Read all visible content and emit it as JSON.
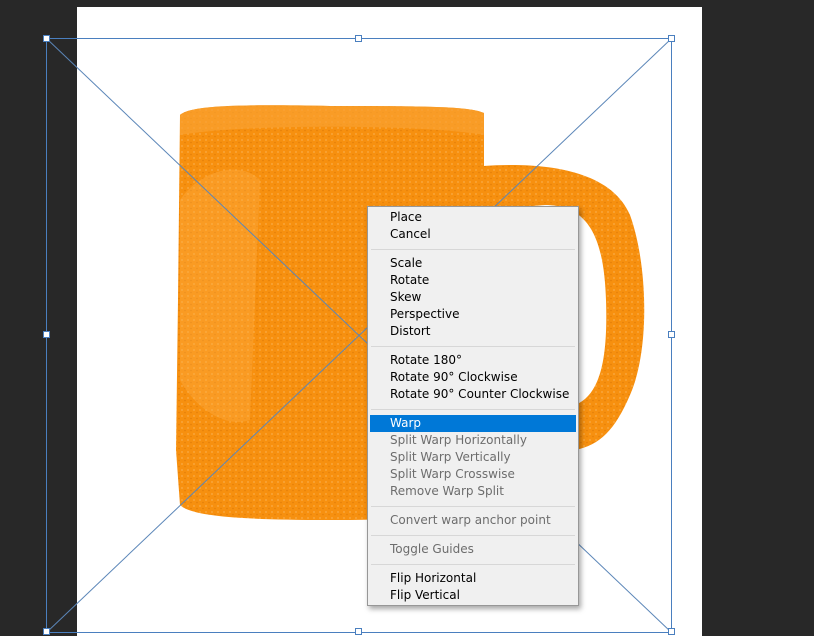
{
  "colors": {
    "workspace_bg": "#282828",
    "document_bg": "#ffffff",
    "mug_orange": "#f7900f",
    "transform_line": "#4a7fbf",
    "menu_bg": "#f0f0f0",
    "menu_highlight": "#0078d7"
  },
  "context_menu": {
    "groups": [
      [
        {
          "label": "Place",
          "enabled": true
        },
        {
          "label": "Cancel",
          "enabled": true
        }
      ],
      [
        {
          "label": "Scale",
          "enabled": true
        },
        {
          "label": "Rotate",
          "enabled": true
        },
        {
          "label": "Skew",
          "enabled": true
        },
        {
          "label": "Perspective",
          "enabled": true
        },
        {
          "label": "Distort",
          "enabled": true
        }
      ],
      [
        {
          "label": "Rotate 180°",
          "enabled": true
        },
        {
          "label": "Rotate 90° Clockwise",
          "enabled": true
        },
        {
          "label": "Rotate 90° Counter Clockwise",
          "enabled": true
        }
      ],
      [
        {
          "label": "Warp",
          "enabled": true,
          "selected": true
        },
        {
          "label": "Split Warp Horizontally",
          "enabled": false
        },
        {
          "label": "Split Warp Vertically",
          "enabled": false
        },
        {
          "label": "Split Warp Crosswise",
          "enabled": false
        },
        {
          "label": "Remove Warp Split",
          "enabled": false
        }
      ],
      [
        {
          "label": "Convert warp anchor point",
          "enabled": false
        }
      ],
      [
        {
          "label": "Toggle Guides",
          "enabled": false
        }
      ],
      [
        {
          "label": "Flip Horizontal",
          "enabled": true
        },
        {
          "label": "Flip Vertical",
          "enabled": true
        }
      ]
    ]
  }
}
